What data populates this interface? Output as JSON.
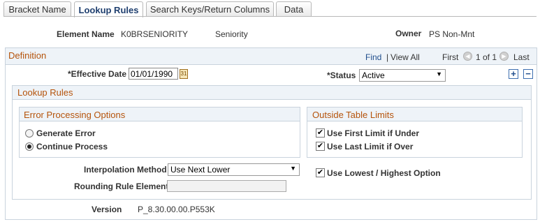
{
  "tabs": [
    {
      "label": "Bracket Name"
    },
    {
      "label": "Lookup Rules"
    },
    {
      "label": "Search Keys/Return Columns"
    },
    {
      "label": "Data"
    }
  ],
  "header": {
    "element_name_label": "Element Name",
    "element_name_value": "K0BRSENIORITY",
    "element_desc": "Seniority",
    "owner_label": "Owner",
    "owner_value": "PS Non-Mnt"
  },
  "definition": {
    "title": "Definition",
    "find": "Find",
    "view_all": "View All",
    "separator": "|",
    "first": "First",
    "paging": "1 of 1",
    "last": "Last",
    "effective_date_label": "*Effective Date",
    "effective_date_value": "01/01/1990",
    "status_label": "*Status",
    "status_value": "Active"
  },
  "lookup_rules": {
    "title": "Lookup Rules",
    "error_processing": {
      "title": "Error Processing Options",
      "options": [
        "Generate Error",
        "Continue Process"
      ],
      "selected": "Continue Process"
    },
    "outside_limits": {
      "title": "Outside Table Limits",
      "use_first_limit": "Use First Limit if Under",
      "use_last_limit": "Use Last Limit if Over"
    },
    "interpolation_label": "Interpolation Method",
    "interpolation_value": "Use Next Lower",
    "rounding_label": "Rounding Rule Element",
    "rounding_value": "",
    "lowest_highest": "Use Lowest / Highest Option"
  },
  "version": {
    "label": "Version",
    "value": "P_8.30.00.00.P553K"
  }
}
